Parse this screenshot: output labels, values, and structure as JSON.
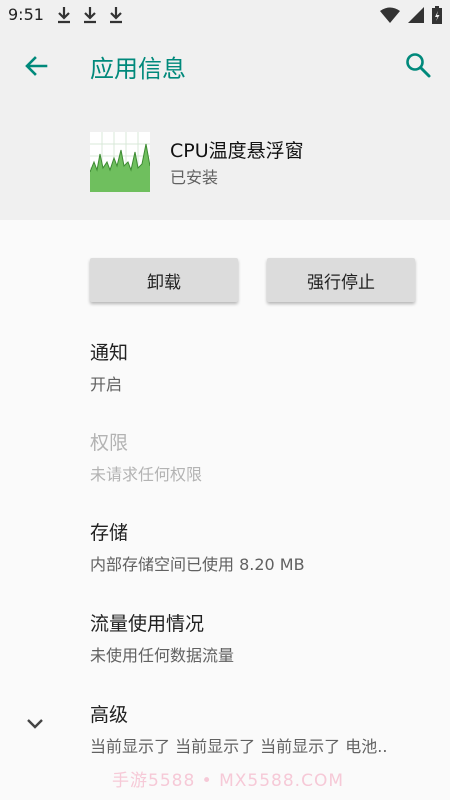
{
  "status_bar": {
    "time": "9:51"
  },
  "app_bar": {
    "title": "应用信息"
  },
  "app": {
    "name": "CPU温度悬浮窗",
    "status": "已安装"
  },
  "buttons": {
    "uninstall": "卸载",
    "force_stop": "强行停止"
  },
  "items": [
    {
      "title": "通知",
      "subtitle": "开启",
      "enabled": true
    },
    {
      "title": "权限",
      "subtitle": "未请求任何权限",
      "enabled": false
    },
    {
      "title": "存储",
      "subtitle": "内部存储空间已使用 8.20 MB",
      "enabled": true
    },
    {
      "title": "流量使用情况",
      "subtitle": "未使用任何数据流量",
      "enabled": true
    },
    {
      "title": "高级",
      "subtitle": "当前显示了 当前显示了 当前显示了 电池..",
      "enabled": true
    }
  ],
  "watermark": "手游5588 • MX5588.COM",
  "colors": {
    "accent": "#00897b",
    "header_bg": "#f0f0f0",
    "body_bg": "#fafafa"
  },
  "icons": [
    "download-icon",
    "wifi-icon",
    "signal-icon",
    "battery-icon",
    "back-arrow-icon",
    "search-icon",
    "cpu-chart-icon",
    "chevron-down-icon"
  ]
}
